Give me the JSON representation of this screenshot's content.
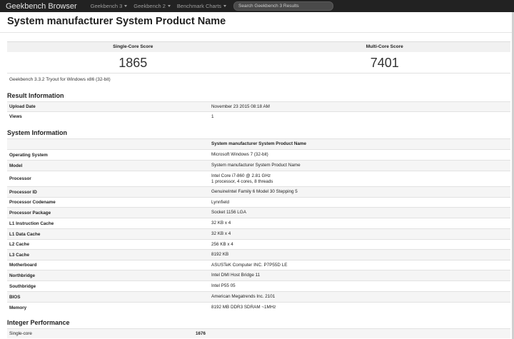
{
  "navbar": {
    "brand": "Geekbench Browser",
    "items": [
      {
        "label": "Geekbench 3"
      },
      {
        "label": "Geekbench 2"
      },
      {
        "label": "Benchmark Charts"
      }
    ],
    "search_placeholder": "Search Geekbench 3 Results"
  },
  "page_title": "System manufacturer System Product Name",
  "scores": {
    "single_label": "Single-Core Score",
    "single_value": "1865",
    "multi_label": "Multi-Core Score",
    "multi_value": "7401"
  },
  "subtitle": "Geekbench 3.3.2 Tryout for Windows x86 (32-bit)",
  "result_info": {
    "heading": "Result Information",
    "rows": [
      {
        "key": "Upload Date",
        "value": "November 23 2015 08:18 AM"
      },
      {
        "key": "Views",
        "value": "1"
      }
    ]
  },
  "system_info": {
    "heading": "System Information",
    "header_value": "System manufacturer System Product Name",
    "rows": [
      {
        "key": "Operating System",
        "value": "Microsoft Windows 7 (32-bit)"
      },
      {
        "key": "Model",
        "value": "System manufacturer System Product Name"
      },
      {
        "key": "Processor",
        "value": "Intel Core i7-860 @ 2.81 GHz",
        "value2": "1 processor, 4 cores, 8 threads"
      },
      {
        "key": "Processor ID",
        "value": "GenuineIntel Family 6 Model 30 Stepping 5"
      },
      {
        "key": "Processor Codename",
        "value": "Lynnfield"
      },
      {
        "key": "Processor Package",
        "value": "Socket 1156 LGA"
      },
      {
        "key": "L1 Instruction Cache",
        "value": "32 KB x 4"
      },
      {
        "key": "L1 Data Cache",
        "value": "32 KB x 4"
      },
      {
        "key": "L2 Cache",
        "value": "256 KB x 4"
      },
      {
        "key": "L3 Cache",
        "value": "8192 KB"
      },
      {
        "key": "Motherboard",
        "value": "ASUSTeK Computer INC. P7P55D LE"
      },
      {
        "key": "Northbridge",
        "value": "Intel DMI Host Bridge 11"
      },
      {
        "key": "Southbridge",
        "value": "Intel P55 05"
      },
      {
        "key": "BIOS",
        "value": "American Megatrends Inc. 2101"
      },
      {
        "key": "Memory",
        "value": "8192 MB DDR3 SDRAM ~1MHz"
      }
    ]
  },
  "integer_perf": {
    "heading": "Integer Performance",
    "rows": [
      {
        "key": "Single-core",
        "value": "1676"
      }
    ]
  }
}
